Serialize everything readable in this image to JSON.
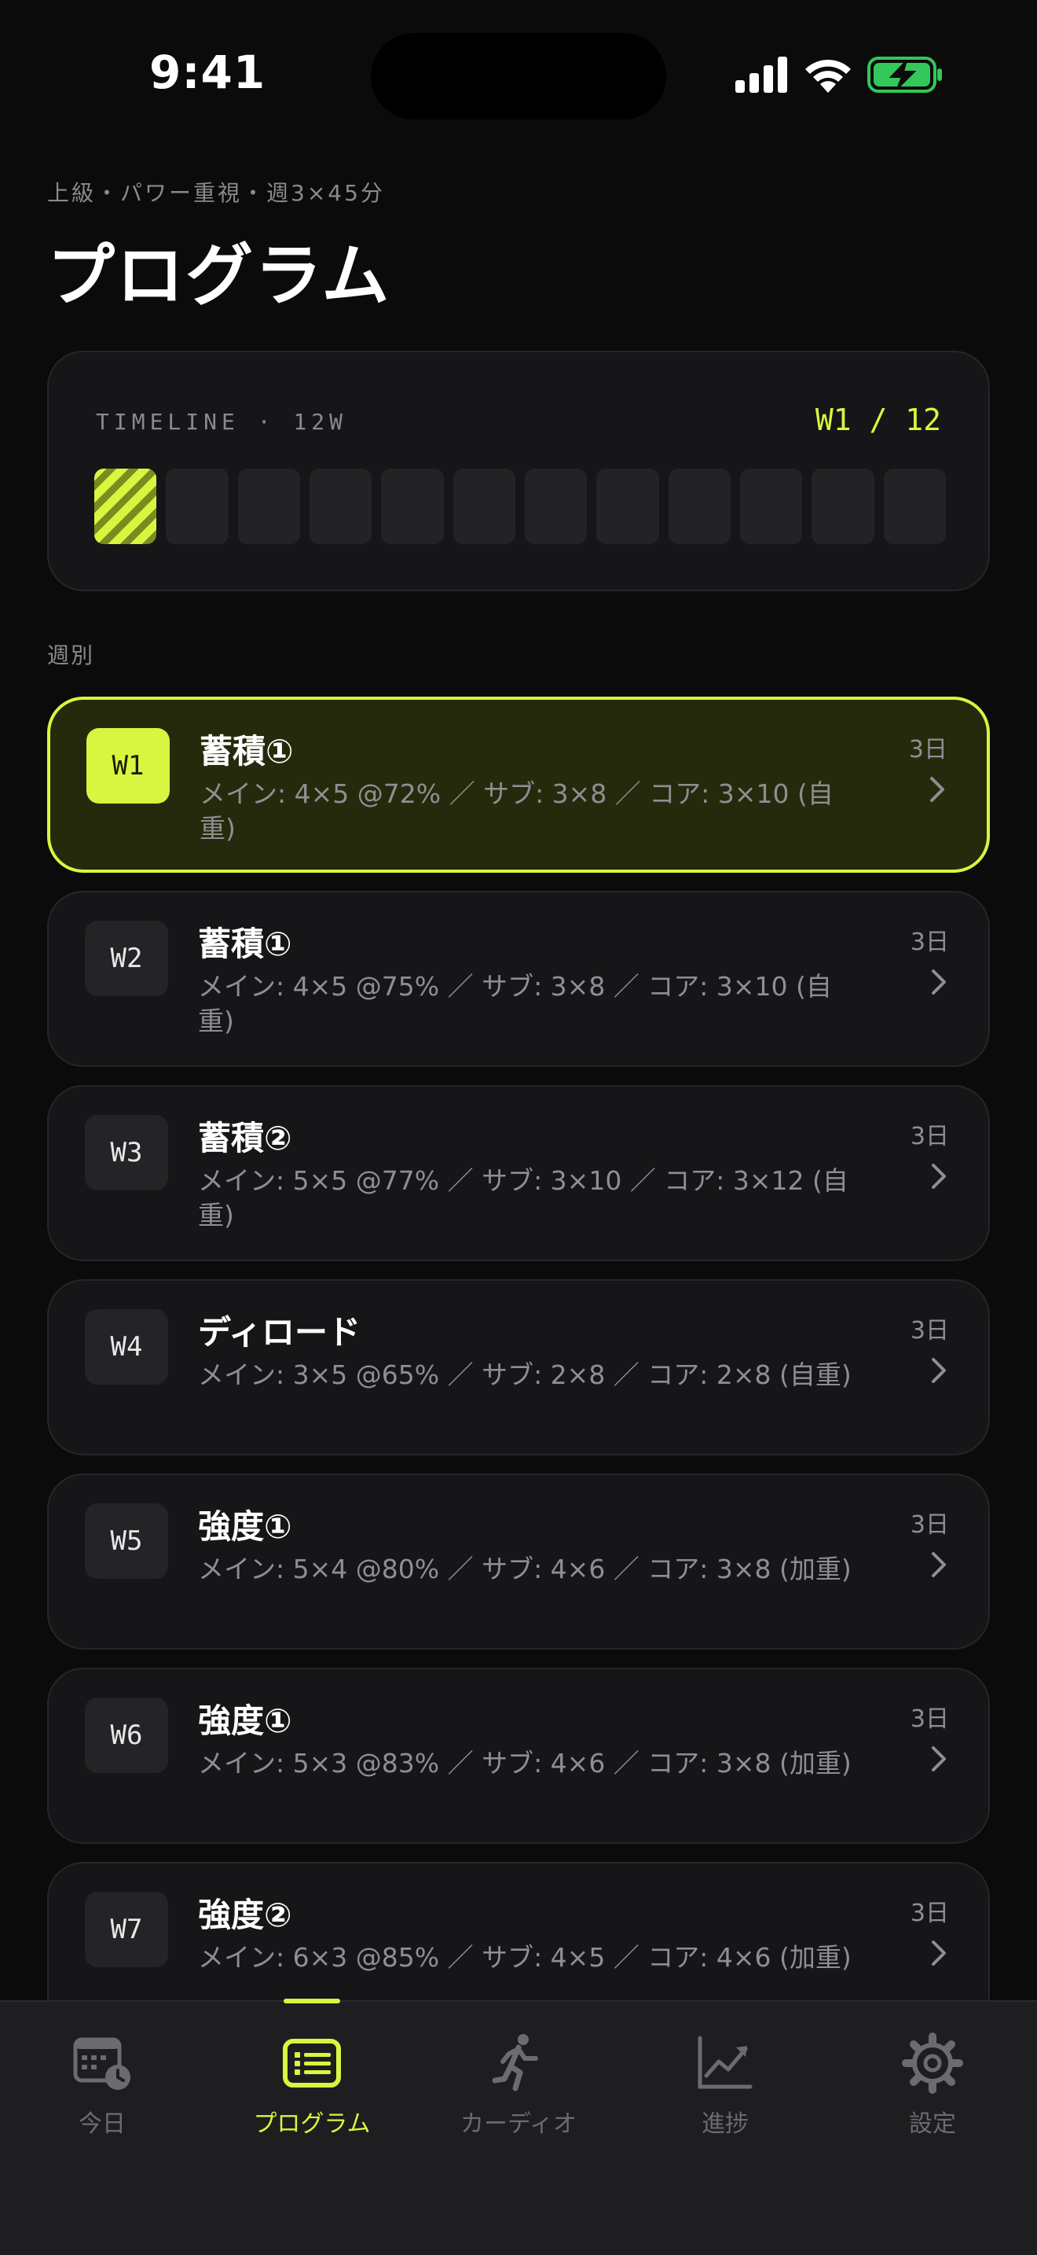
{
  "status_bar": {
    "time": "9:41"
  },
  "header": {
    "subtitle": "上級・パワー重視・週3×45分",
    "title": "プログラム"
  },
  "timeline": {
    "label": "TIMELINE · 12W",
    "current": "W1 / 12",
    "total_weeks": 12,
    "current_week": 1
  },
  "section_label": "週別",
  "weeks": [
    {
      "code": "W1",
      "name": "蓄積①",
      "detail": "メイン: 4×5 @72% ／ サブ: 3×8 ／ コア: 3×10 (自重)",
      "days": "3日",
      "active": true
    },
    {
      "code": "W2",
      "name": "蓄積①",
      "detail": "メイン: 4×5 @75% ／ サブ: 3×8 ／ コア: 3×10 (自重)",
      "days": "3日",
      "active": false
    },
    {
      "code": "W3",
      "name": "蓄積②",
      "detail": "メイン: 5×5 @77% ／ サブ: 3×10 ／ コア: 3×12 (自重)",
      "days": "3日",
      "active": false
    },
    {
      "code": "W4",
      "name": "ディロード",
      "detail": "メイン: 3×5 @65% ／ サブ: 2×8 ／ コア: 2×8 (自重)",
      "days": "3日",
      "active": false
    },
    {
      "code": "W5",
      "name": "強度①",
      "detail": "メイン: 5×4 @80% ／ サブ: 4×6 ／ コア: 3×8 (加重)",
      "days": "3日",
      "active": false
    },
    {
      "code": "W6",
      "name": "強度①",
      "detail": "メイン: 5×3 @83% ／ サブ: 4×6 ／ コア: 3×8 (加重)",
      "days": "3日",
      "active": false
    },
    {
      "code": "W7",
      "name": "強度②",
      "detail": "メイン: 6×3 @85% ／ サブ: 4×5 ／ コア: 4×6 (加重)",
      "days": "3日",
      "active": false
    }
  ],
  "tabs": [
    {
      "label": "今日",
      "icon": "calendar-clock-icon",
      "active": false
    },
    {
      "label": "プログラム",
      "icon": "list-icon",
      "active": true
    },
    {
      "label": "カーディオ",
      "icon": "running-person-icon",
      "active": false
    },
    {
      "label": "進捗",
      "icon": "chart-line-icon",
      "active": false
    },
    {
      "label": "設定",
      "icon": "gear-icon",
      "active": false
    }
  ],
  "colors": {
    "accent": "#d8f63f",
    "background": "#0b0b0c",
    "card": "#161618",
    "muted_text": "#8e8e93",
    "battery_green": "#34c759"
  }
}
